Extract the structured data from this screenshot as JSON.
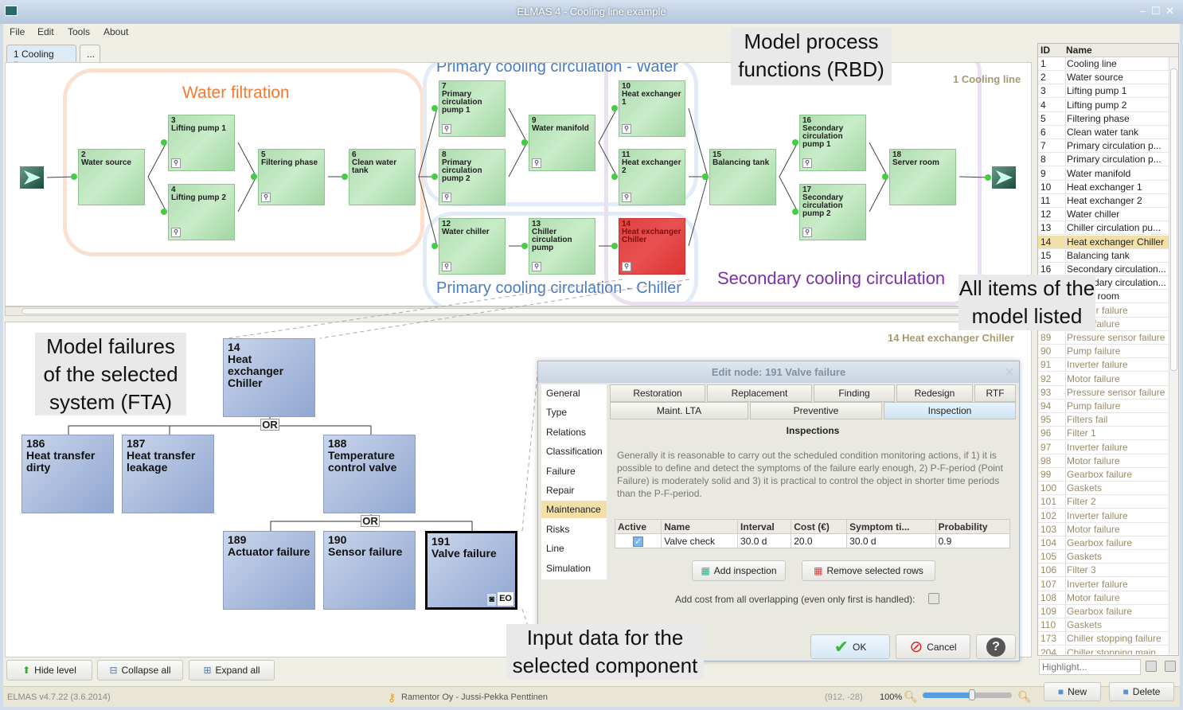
{
  "window": {
    "title": "ELMAS 4 - Cooling line example",
    "minimize": "‒",
    "maximize": "☐",
    "close": "✕"
  },
  "menu": [
    "File",
    "Edit",
    "Tools",
    "About"
  ],
  "tabs": [
    {
      "label": "1 Cooling line",
      "active": true
    },
    {
      "label": "...",
      "active": false
    }
  ],
  "rbd": {
    "context_label": "1 Cooling line",
    "groups": [
      {
        "label": "Water filtration",
        "color": "#f47a30"
      },
      {
        "label": "Primary cooling circulation - Water",
        "color": "#4a7cc0"
      },
      {
        "label": "Primary cooling circulation - Chiller",
        "color": "#4a7cc0"
      },
      {
        "label": "Secondary cooling circulation",
        "color": "#7a30a8"
      }
    ],
    "nodes": [
      {
        "id": "2",
        "name": "Water source"
      },
      {
        "id": "3",
        "name": "Lifting pump 1"
      },
      {
        "id": "4",
        "name": "Lifting pump 2"
      },
      {
        "id": "5",
        "name": "Filtering phase"
      },
      {
        "id": "6",
        "name": "Clean water tank"
      },
      {
        "id": "7",
        "name": "Primary circulation pump 1"
      },
      {
        "id": "8",
        "name": "Primary circulation pump 2"
      },
      {
        "id": "9",
        "name": "Water manifold"
      },
      {
        "id": "10",
        "name": "Heat exchanger 1"
      },
      {
        "id": "11",
        "name": "Heat exchanger 2"
      },
      {
        "id": "12",
        "name": "Water chiller"
      },
      {
        "id": "13",
        "name": "Chiller circulation pump"
      },
      {
        "id": "14",
        "name": "Heat exchanger Chiller",
        "failed": true
      },
      {
        "id": "15",
        "name": "Balancing tank"
      },
      {
        "id": "16",
        "name": "Secondary circulation pump 1"
      },
      {
        "id": "17",
        "name": "Secondary circulation pump 2"
      },
      {
        "id": "18",
        "name": "Server room"
      }
    ]
  },
  "callouts": {
    "rbd": "Model process functions (RBD)",
    "items": "All items of the model listed",
    "fta": "Model failures of the selected system (FTA)",
    "input": "Input data for the selected component"
  },
  "fta": {
    "context_label": "14 Heat exchanger Chiller",
    "gate": "OR",
    "nodes": [
      {
        "id": "14",
        "name": "Heat exchanger Chiller"
      },
      {
        "id": "186",
        "name": "Heat transfer dirty"
      },
      {
        "id": "187",
        "name": "Heat transfer leakage"
      },
      {
        "id": "188",
        "name": "Temperature control valve"
      },
      {
        "id": "189",
        "name": "Actuator failure"
      },
      {
        "id": "190",
        "name": "Sensor failure"
      },
      {
        "id": "191",
        "name": "Valve failure",
        "selected": true,
        "badge": "EO"
      }
    ],
    "buttons": {
      "hide": "Hide level",
      "collapse": "Collapse all",
      "expand": "Expand all"
    }
  },
  "dialog": {
    "title": "Edit node: 191 Valve failure",
    "nav": [
      "General",
      "Type",
      "Relations",
      "Classification",
      "Failure",
      "Repair",
      "Maintenance",
      "Risks",
      "Line",
      "Simulation"
    ],
    "nav_selected": "Maintenance",
    "tabs_row1": [
      "Restoration",
      "Replacement",
      "Finding",
      "Redesign",
      "RTF"
    ],
    "tabs_row2": [
      "Maint. LTA",
      "Preventive",
      "Inspection"
    ],
    "tab_selected": "Inspection",
    "heading": "Inspections",
    "description": "Generally it is reasonable to carry out the scheduled condition monitoring actions, if 1) it is possible to define and detect the symptoms of the failure early enough, 2) P-F-period (Point Failure) is moderately solid and 3) it is practical to control the object in shorter time periods than the P-F-period.",
    "table": {
      "columns": [
        "Active",
        "Name",
        "Interval",
        "Cost (€)",
        "Symptom ti...",
        "Probability"
      ],
      "rows": [
        {
          "active": true,
          "name": "Valve check",
          "interval": "30.0 d",
          "cost": "20.0",
          "symptom": "30.0 d",
          "probability": "0.9"
        }
      ]
    },
    "add_button": "Add inspection",
    "remove_button": "Remove selected rows",
    "overlap_label": "Add cost from all overlapping (even only first is handled):",
    "overlap_checked": false,
    "ok": "OK",
    "cancel": "Cancel",
    "help": "?"
  },
  "items": {
    "columns": [
      "ID",
      "Name"
    ],
    "selected_id": "14",
    "rows": [
      [
        "1",
        "Cooling line"
      ],
      [
        "2",
        "Water source"
      ],
      [
        "3",
        "Lifting pump 1"
      ],
      [
        "4",
        "Lifting pump 2"
      ],
      [
        "5",
        "Filtering phase"
      ],
      [
        "6",
        "Clean water tank"
      ],
      [
        "7",
        "Primary circulation p..."
      ],
      [
        "8",
        "Primary circulation p..."
      ],
      [
        "9",
        "Water manifold"
      ],
      [
        "10",
        "Heat exchanger 1"
      ],
      [
        "11",
        "Heat exchanger 2"
      ],
      [
        "12",
        "Water chiller"
      ],
      [
        "13",
        "Chiller circulation pu..."
      ],
      [
        "14",
        "Heat exchanger Chiller"
      ],
      [
        "15",
        "Balancing tank"
      ],
      [
        "16",
        "Secondary circulation..."
      ],
      [
        "17",
        "Secondary circulation..."
      ],
      [
        "18",
        "Server room"
      ],
      [
        "87",
        "Inverter failure",
        "f"
      ],
      [
        "88",
        "Motor failure",
        "f"
      ],
      [
        "89",
        "Pressure sensor failure",
        "f"
      ],
      [
        "90",
        "Pump failure",
        "f"
      ],
      [
        "91",
        "Inverter failure",
        "f"
      ],
      [
        "92",
        "Motor failure",
        "f"
      ],
      [
        "93",
        "Pressure sensor failure",
        "f"
      ],
      [
        "94",
        "Pump failure",
        "f"
      ],
      [
        "95",
        "Filters fail",
        "f"
      ],
      [
        "96",
        "Filter 1",
        "f"
      ],
      [
        "97",
        "Inverter failure",
        "f"
      ],
      [
        "98",
        "Motor failure",
        "f"
      ],
      [
        "99",
        "Gearbox failure",
        "f"
      ],
      [
        "100",
        "Gaskets",
        "f"
      ],
      [
        "101",
        "Filter 2",
        "f"
      ],
      [
        "102",
        "Inverter failure",
        "f"
      ],
      [
        "103",
        "Motor failure",
        "f"
      ],
      [
        "104",
        "Gearbox failure",
        "f"
      ],
      [
        "105",
        "Gaskets",
        "f"
      ],
      [
        "106",
        "Filter 3",
        "f"
      ],
      [
        "107",
        "Inverter failure",
        "f"
      ],
      [
        "108",
        "Motor failure",
        "f"
      ],
      [
        "109",
        "Gearbox failure",
        "f"
      ],
      [
        "110",
        "Gaskets",
        "f"
      ],
      [
        "173",
        "Chiller stopping failure",
        "f"
      ],
      [
        "204",
        "Chiller stopping main",
        "f"
      ]
    ],
    "highlight_placeholder": "Highlight...",
    "new": "New",
    "delete": "Delete"
  },
  "status": {
    "version": "ELMAS v4.7.22 (3.6.2014)",
    "license": "Ramentor Oy - Jussi-Pekka Penttinen",
    "coords": "(912, -28)",
    "zoom": "100%",
    "zoom_level_percent": 100
  }
}
